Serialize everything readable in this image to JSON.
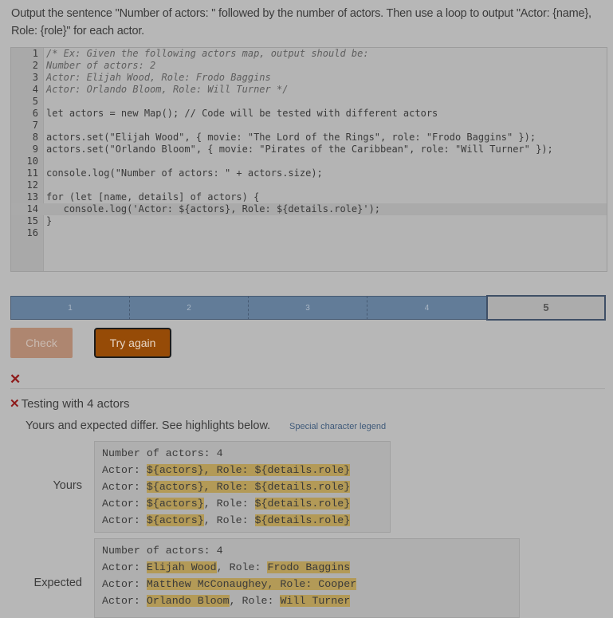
{
  "prompt": "Output the sentence \"Number of actors: \" followed by the number of actors. Then use a loop to output \"Actor: {name}, Role: {role}\" for each actor.",
  "editor": {
    "line_numbers": [
      "1",
      "2",
      "3",
      "4",
      "5",
      "6",
      "7",
      "8",
      "9",
      "10",
      "11",
      "12",
      "13",
      "14",
      "15",
      "16"
    ],
    "lines": [
      "/* Ex: Given the following actors map, output should be:",
      "Number of actors: 2",
      "Actor: Elijah Wood, Role: Frodo Baggins",
      "Actor: Orlando Bloom, Role: Will Turner */",
      "",
      "let actors = new Map(); // Code will be tested with different actors",
      "",
      "actors.set(\"Elijah Wood\", { movie: \"The Lord of the Rings\", role: \"Frodo Baggins\" });",
      "actors.set(\"Orlando Bloom\", { movie: \"Pirates of the Caribbean\", role: \"Will Turner\" });",
      "",
      "console.log(\"Number of actors: \" + actors.size);",
      "",
      "for (let [name, details] of actors) {",
      "   console.log('Actor: ${actors}, Role: ${details.role}');",
      "}",
      ""
    ],
    "active_line": 14
  },
  "progress": {
    "segments": [
      "1",
      "2",
      "3",
      "4",
      "5"
    ],
    "current": 5
  },
  "buttons": {
    "check": "Check",
    "try_again": "Try again"
  },
  "result": {
    "status_icon": "x-icon",
    "test_label": "Testing with 4 actors",
    "differ_message": "Yours and expected differ. See highlights below.",
    "legend_link": "Special character legend",
    "yours_label": "Yours",
    "expected_label": "Expected",
    "yours_lines": [
      "Number of actors: 4",
      "Actor: ${actors}, Role: ${details.role}",
      "Actor: ${actors}, Role: ${details.role}",
      "Actor: ${actors}, Role: ${details.role}",
      "Actor: ${actors}, Role: ${details.role}"
    ],
    "expected_lines": [
      "Number of actors: 4",
      "Actor: Elijah Wood, Role: Frodo Baggins",
      "Actor: Matthew McConaughey, Role: Cooper",
      "Actor: Orlando Bloom, Role: Will Turner"
    ]
  },
  "colors": {
    "progress_done": "#627c98",
    "try_again_bg": "#964b07",
    "check_bg": "#ae8670",
    "error_x": "#8e1b1b",
    "diff_highlight": "#b39a57"
  }
}
